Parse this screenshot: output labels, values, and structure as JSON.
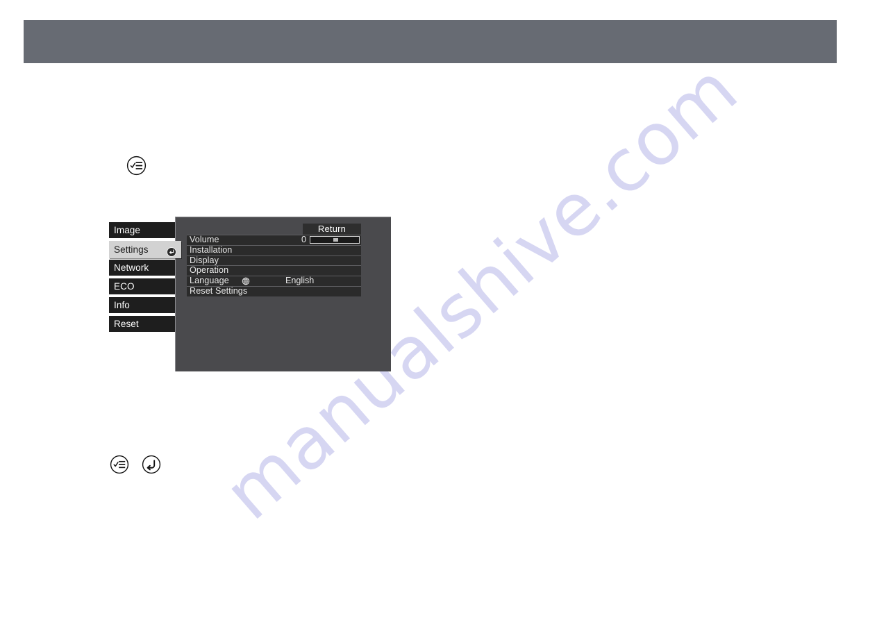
{
  "page": {
    "background_color": "#ffffff",
    "header_band_color": "#676b73",
    "watermark": {
      "text": "manualshive.com",
      "color": "#d6d6f2",
      "rotation_deg": -41
    }
  },
  "step_icons": [
    {
      "name": "menu-icon",
      "glyph": "menu-checklist",
      "position": "top"
    },
    {
      "name": "menu-icon",
      "glyph": "menu-checklist",
      "position": "bottom-left"
    },
    {
      "name": "esc-back-icon",
      "glyph": "return-arrow",
      "position": "bottom-right"
    }
  ],
  "osd": {
    "nav": {
      "items": [
        {
          "label": "Image",
          "selected": false
        },
        {
          "label": "Settings",
          "selected": true,
          "badge": "enter-icon"
        },
        {
          "label": "Network",
          "selected": false
        },
        {
          "label": "ECO",
          "selected": false
        },
        {
          "label": "Info",
          "selected": false
        },
        {
          "label": "Reset",
          "selected": false
        }
      ]
    },
    "panel": {
      "return_label": "Return",
      "rows": [
        {
          "label": "Volume",
          "value": "0",
          "control": "slider",
          "slider_position_pct": 46
        },
        {
          "label": "Installation",
          "value": ""
        },
        {
          "label": "Display",
          "value": ""
        },
        {
          "label": "Operation",
          "value": ""
        },
        {
          "label": "Language",
          "value": "English",
          "icon": "globe-icon"
        },
        {
          "label": "Reset Settings",
          "value": ""
        }
      ]
    },
    "colors": {
      "nav_item_bg": "#1e1e1e",
      "nav_selected_bg": "#d2d2d2",
      "panel_bg": "#4a4a4d",
      "row_bg": "#2b2b2b",
      "row_divider": "#5f5f62"
    }
  }
}
